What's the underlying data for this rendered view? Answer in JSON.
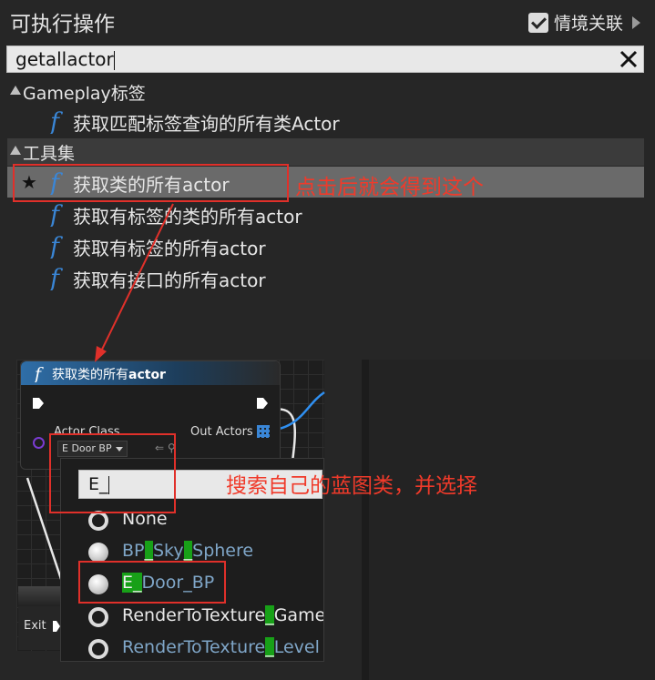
{
  "panel": {
    "title": "可执行操作",
    "context_label": "情境关联",
    "search_value": "getallactor"
  },
  "categories": [
    {
      "label": "Gameplay标签"
    },
    {
      "label": "工具集"
    }
  ],
  "items": [
    {
      "label": "获取匹配标签查询的所有类Actor"
    },
    {
      "label": "获取类的所有actor",
      "selected": true
    },
    {
      "label": "获取有标签的类的所有actor"
    },
    {
      "label": "获取有标签的所有actor"
    },
    {
      "label": "获取有接口的所有actor"
    }
  ],
  "annotations": {
    "click_note": "点击后就会得到这个",
    "search_note": "搜索自己的蓝图类，并选择"
  },
  "node": {
    "title": "获取类的所有",
    "title_bold": "actor",
    "actor_class_label": "Actor Class",
    "out_actors_label": "Out Actors",
    "class_value": "E Door BP",
    "exit_label": "Exit"
  },
  "popup": {
    "search_value": "E_",
    "options": [
      {
        "parts": [
          "None"
        ],
        "style": "white",
        "radio": "empty"
      },
      {
        "parts": [
          "BP",
          "_",
          "Sky",
          "_",
          "Sphere"
        ],
        "style": "blue",
        "radio": "filled"
      },
      {
        "parts": [
          "E_",
          "Door_BP"
        ],
        "style": "blue",
        "radio": "filled"
      },
      {
        "parts": [
          "RenderToTexture",
          "_",
          "Game"
        ],
        "style": "white",
        "radio": "empty"
      },
      {
        "parts": [
          "RenderToTexture",
          "_",
          "Level"
        ],
        "style": "blue",
        "radio": "empty"
      }
    ]
  },
  "colors": {
    "annotation_red": "#e0302a",
    "match_highlight": "#18a018",
    "function_icon": "#3a86d6"
  }
}
